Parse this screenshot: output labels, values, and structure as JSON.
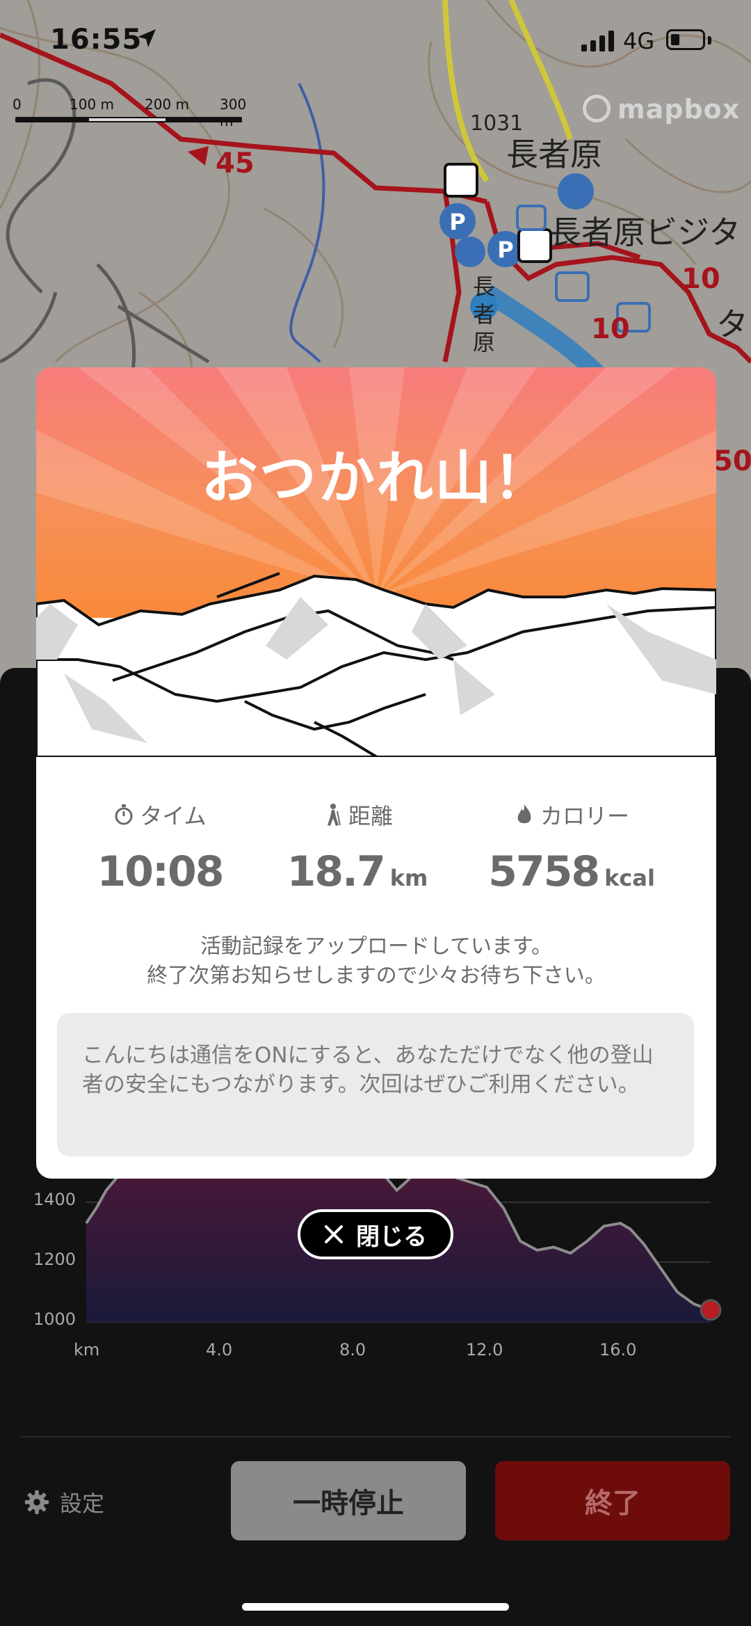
{
  "status_bar": {
    "time": "16:55",
    "network": "4G"
  },
  "map": {
    "scale": [
      "0",
      "100 m",
      "200 m",
      "300 m"
    ],
    "attribution": "mapbox",
    "labels": {
      "place": "長者原",
      "visitor_center": "長者原ビジタ",
      "elevation": "1031",
      "route_45": "45",
      "route_10a": "10",
      "route_10b": "10",
      "route_50": "50",
      "ta": "タ",
      "vertical": "長者原"
    }
  },
  "modal": {
    "title": "おつかれ山！",
    "stats": [
      {
        "label": "タイム",
        "value": "10:08",
        "unit": ""
      },
      {
        "label": "距離",
        "value": "18.7",
        "unit": "km"
      },
      {
        "label": "カロリー",
        "value": "5758",
        "unit": "kcal"
      }
    ],
    "upload_message_line1": "活動記録をアップロードしています。",
    "upload_message_line2": "終了次第お知らせしますので少々お待ち下さい。",
    "note": "こんにちは通信をONにすると、あなただけでなく他の登山者の安全にもつながります。次回はぜひご利用ください。"
  },
  "close_button": {
    "label": "閉じる"
  },
  "elevation_chart": {
    "y_ticks": [
      "1400",
      "1200",
      "1000"
    ],
    "x_ticks": [
      "km",
      "4.0",
      "8.0",
      "12.0",
      "16.0"
    ]
  },
  "chart_data": {
    "type": "area",
    "xlabel": "km",
    "ylabel": "",
    "ylim": [
      1000,
      1500
    ],
    "xlim": [
      0,
      18.7
    ],
    "x": [
      0,
      0.3,
      0.6,
      0.9,
      1.2,
      8.5,
      9.0,
      9.3,
      9.6,
      10.0,
      12.0,
      12.5,
      13.0,
      13.5,
      14.0,
      14.5,
      15.0,
      15.5,
      16.0,
      16.3,
      16.7,
      17.2,
      17.7,
      18.2,
      18.7
    ],
    "series": [
      {
        "values": [
          1330,
          1380,
          1440,
          1480,
          1520,
          1520,
          1480,
          1440,
          1470,
          1520,
          1450,
          1380,
          1270,
          1240,
          1250,
          1230,
          1270,
          1320,
          1330,
          1310,
          1260,
          1180,
          1100,
          1060,
          1040
        ]
      }
    ],
    "colors": {
      "line": "#8c8c8c",
      "fill_top": "#4a1838",
      "fill_bottom": "#1a1a3a",
      "end_marker": "#b81d22"
    }
  }
}
